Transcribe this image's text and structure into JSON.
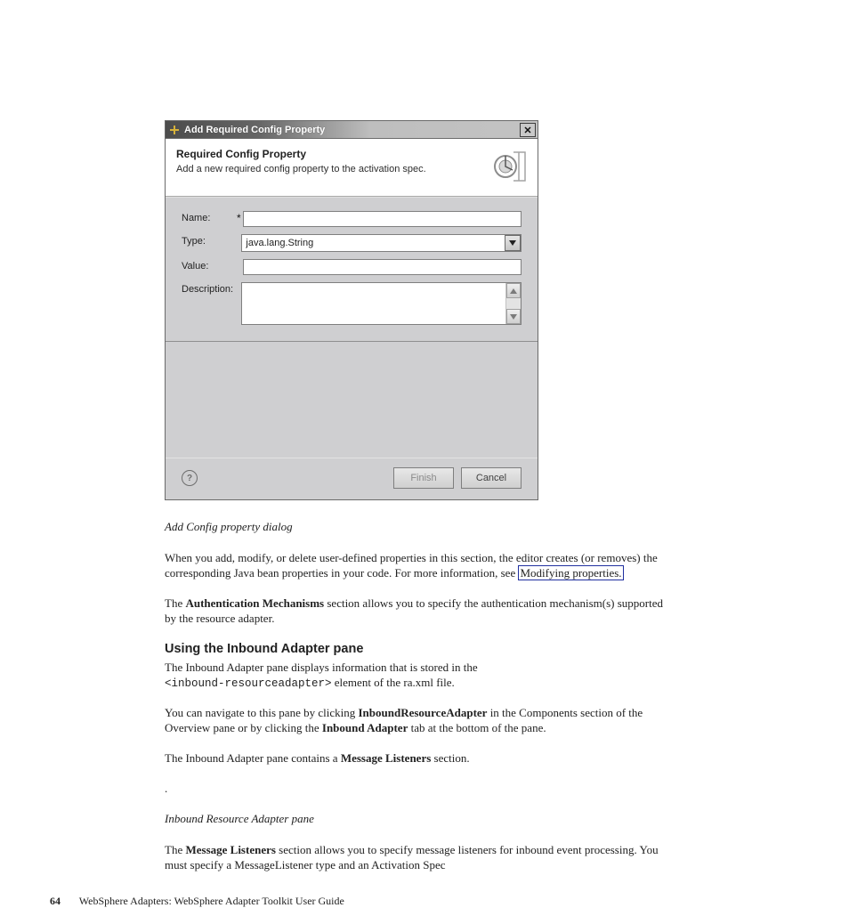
{
  "dialog": {
    "title": "Add Required Config Property",
    "banner_heading": "Required Config Property",
    "banner_desc": "Add a new required config property to the activation spec.",
    "labels": {
      "name": "Name:",
      "type": "Type:",
      "value": "Value:",
      "description": "Description:"
    },
    "values": {
      "name": "",
      "type_selected": "java.lang.String",
      "value": "",
      "description": ""
    },
    "required_marker": "*",
    "buttons": {
      "finish": "Finish",
      "cancel": "Cancel"
    },
    "help": "?"
  },
  "doc": {
    "caption1": "Add Config property dialog",
    "para1a": "When you add, modify, or delete user-defined properties in this section, the editor creates (or removes) the corresponding Java bean properties in your code. For more information, see ",
    "para1_link": "Modifying properties.",
    "para2a": "The ",
    "para2b": "Authentication Mechanisms",
    "para2c": " section allows you to specify the authentication mechanism(s) supported by the resource adapter.",
    "heading1": "Using the Inbound Adapter pane",
    "para3a": "The Inbound Adapter pane displays information that is stored in the ",
    "para3_code": "<inbound-resourceadapter>",
    "para3b": " element of the ra.xml file.",
    "para4a": "You can navigate to this pane by clicking ",
    "para4b": "InboundResourceAdapter",
    "para4c": " in the Components section of the Overview pane or by clicking the ",
    "para4d": "Inbound Adapter",
    "para4e": " tab at the bottom of the pane.",
    "para5a": "The Inbound Adapter pane contains a ",
    "para5b": "Message Listeners",
    "para5c": " section.",
    "dot": ".",
    "caption2": "Inbound Resource Adapter pane",
    "para6a": "The ",
    "para6b": "Message Listeners",
    "para6c": " section allows you to specify message listeners for inbound event processing. You must specify a MessageListener type and an Activation Spec"
  },
  "footer": {
    "page": "64",
    "book": "WebSphere Adapters: WebSphere Adapter Toolkit User Guide"
  }
}
